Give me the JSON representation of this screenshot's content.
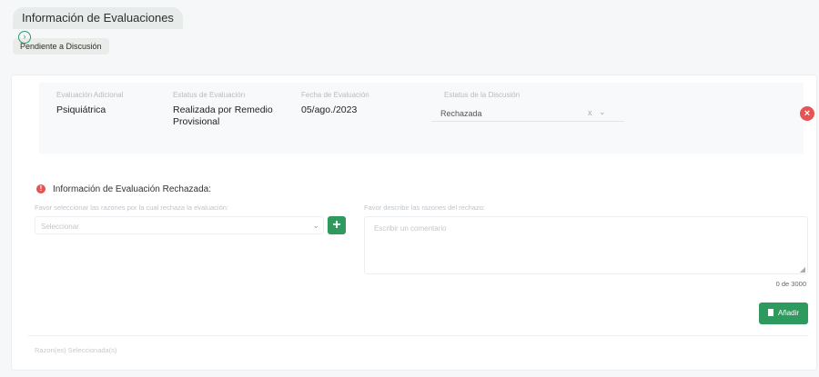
{
  "header": {
    "title": "Información de Evaluaciones"
  },
  "status_chip": "Pendiente a Discusión",
  "evaluation": {
    "fields": [
      {
        "label": "Evaluación Adicional",
        "value": "Psiquiátrica"
      },
      {
        "label": "Estatus de Evaluación",
        "value": "Realizada por Remedio Provisional"
      },
      {
        "label": "Fecha de Evaluación",
        "value": "05/ago./2023"
      },
      {
        "label": "Estatus de la Discusión"
      }
    ],
    "discussion_status": {
      "value": "Rechazada",
      "clear": "x",
      "chevron": "⌄"
    }
  },
  "rejected": {
    "title": "Información de Evaluación Rechazada:",
    "reason_label": "Favor seleccionar las razones por la cual rechaza la evaluación:",
    "reason_placeholder": "Seleccionar",
    "description_label": "Favor describir las razones del rechazo:",
    "description_placeholder": "Escribir un comentario",
    "char_count": "0 de 3000",
    "add_button": "Añadir"
  },
  "footer": {
    "selected_text": "Razon(es) Seleccionada(s)"
  },
  "colors": {
    "accent_green": "#2e9a5e",
    "danger_red": "#e55353"
  },
  "icons": [
    "expand-circle-icon",
    "remove-circle-icon",
    "alert-icon",
    "plus-icon",
    "document-icon"
  ]
}
